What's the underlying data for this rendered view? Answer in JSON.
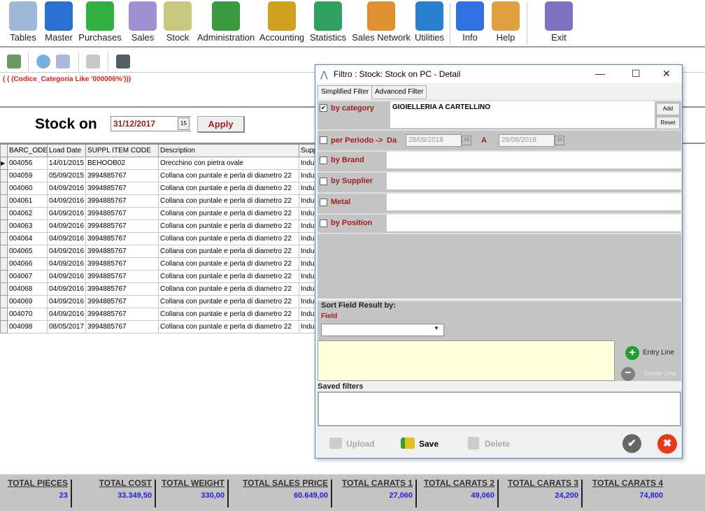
{
  "menu": {
    "items": [
      {
        "label": "Tables",
        "icon": "table-edit-icon",
        "color": "#9fb8d8"
      },
      {
        "label": "Master",
        "icon": "folder-box-icon",
        "color": "#2a70d0"
      },
      {
        "label": "Purchases",
        "icon": "money-icon",
        "color": "#30b040"
      },
      {
        "label": "Sales",
        "icon": "cart-icon",
        "color": "#a090d0"
      },
      {
        "label": "Stock",
        "icon": "shelf-icon",
        "color": "#c8c880"
      },
      {
        "label": "Administration",
        "icon": "books-icon",
        "color": "#3a9a40"
      },
      {
        "label": "Accounting",
        "icon": "money-bag-icon",
        "color": "#d0a020"
      },
      {
        "label": "Statistics",
        "icon": "chart-icon",
        "color": "#30a060"
      },
      {
        "label": "Sales Network",
        "icon": "person-icon",
        "color": "#e09030"
      },
      {
        "label": "Utilities",
        "icon": "checklist-icon",
        "color": "#2a80d0"
      },
      {
        "label": "Info",
        "icon": "info-icon",
        "color": "#3070e0"
      },
      {
        "label": "Help",
        "icon": "headset-icon",
        "color": "#e0a040"
      },
      {
        "label": "Exit",
        "icon": "exit-door-icon",
        "color": "#8070c0"
      }
    ]
  },
  "toolbar": {
    "icons": [
      "exit-icon",
      "search-icon",
      "copy-icon",
      "print-icon",
      "import-icon"
    ]
  },
  "filter_expression": "( ( (Codice_Categoria Like '000006%')))",
  "stock_on": {
    "label": "Stock on",
    "date": "31/12/2017",
    "calendar": "15",
    "apply": "Apply"
  },
  "grid": {
    "columns": [
      "BARC_ODE",
      "Load Date",
      "SUPPL ITEM CODE",
      "Description",
      "Supp"
    ],
    "rows": [
      [
        "004056",
        "14/01/2015",
        "BEHOOB02",
        "Orecchino con pietra ovale",
        "Indus"
      ],
      [
        "004059",
        "05/09/2015",
        "3994885767",
        "Collana con puntale e perla di diametro 22",
        "Indus"
      ],
      [
        "004060",
        "04/09/2016",
        "3994885767",
        "Collana con puntale e perla di diametro 22",
        "Indus"
      ],
      [
        "004061",
        "04/09/2016",
        "3994885767",
        "Collana con puntale e perla di diametro 22",
        "Indus"
      ],
      [
        "004062",
        "04/09/2016",
        "3994885767",
        "Collana con puntale e perla di diametro 22",
        "Indus"
      ],
      [
        "004063",
        "04/09/2016",
        "3994885767",
        "Collana con puntale e perla di diametro 22",
        "Indus"
      ],
      [
        "004064",
        "04/09/2016",
        "3994885767",
        "Collana con puntale e perla di diametro 22",
        "Indus"
      ],
      [
        "004065",
        "04/09/2016",
        "3994885767",
        "Collana con puntale e perla di diametro 22",
        "Indus"
      ],
      [
        "004066",
        "04/09/2016",
        "3994885767",
        "Collana con puntale e perla di diametro 22",
        "Indus"
      ],
      [
        "004067",
        "04/09/2016",
        "3994885767",
        "Collana con puntale e perla di diametro 22",
        "Indus"
      ],
      [
        "004068",
        "04/09/2016",
        "3994885767",
        "Collana con puntale e perla di diametro 22",
        "Indus"
      ],
      [
        "004069",
        "04/09/2016",
        "3994885767",
        "Collana con puntale e perla di diametro 22",
        "Indus"
      ],
      [
        "004070",
        "04/09/2016",
        "3994885767",
        "Collana con puntale e perla di diametro 22",
        "Indus"
      ],
      [
        "004098",
        "08/05/2017",
        "3994885767",
        "Collana con puntale e perla di diametro 22",
        "Indus"
      ]
    ]
  },
  "totals": [
    {
      "label": "TOTAL PIECES",
      "value": "23"
    },
    {
      "label": "TOTAL COST",
      "value": "33.349,50"
    },
    {
      "label": "TOTAL WEIGHT",
      "value": "330,00"
    },
    {
      "label": "TOTAL SALES PRICE",
      "value": "60.649,00"
    },
    {
      "label": "TOTAL CARATS 1",
      "value": "27,060"
    },
    {
      "label": "TOTAL CARATS 2",
      "value": "49,060"
    },
    {
      "label": "TOTAL CARATS 3",
      "value": "24,200"
    },
    {
      "label": "TOTAL CARATS 4",
      "value": "74,800"
    }
  ],
  "dialog": {
    "title": "Filtro : Stock: Stock on PC - Detail",
    "minimize": "—",
    "maximize": "☐",
    "close": "✕",
    "tabs": [
      "Simplified Filter",
      "Advanced Filter"
    ],
    "category": {
      "label": "by category",
      "checked": true,
      "value": "GIOIELLERIA A CARTELLINO",
      "add": "Add",
      "reset": "Reset"
    },
    "period": {
      "label": "per Periodo ->",
      "checked": false,
      "from_label": "Da",
      "from": "28/08/2018",
      "to_label": "A",
      "to": "28/08/2018",
      "calendar": "15"
    },
    "brand": {
      "label": "by Brand",
      "checked": false
    },
    "supplier": {
      "label": "by Supplier",
      "checked": false
    },
    "metal": {
      "label": "Metal",
      "checked": false
    },
    "position": {
      "label": "by Position",
      "checked": false
    },
    "sort": {
      "title": "Sort Field Result by:",
      "field_label": "Field",
      "field_value": "",
      "entry_line": "Entry Line",
      "delete_line": "Delete Line"
    },
    "saved": {
      "title": "Saved filters"
    },
    "buttons": {
      "upload": "Upload",
      "save": "Save",
      "delete": "Delete",
      "ok": "✔",
      "cancel": "✖"
    }
  }
}
